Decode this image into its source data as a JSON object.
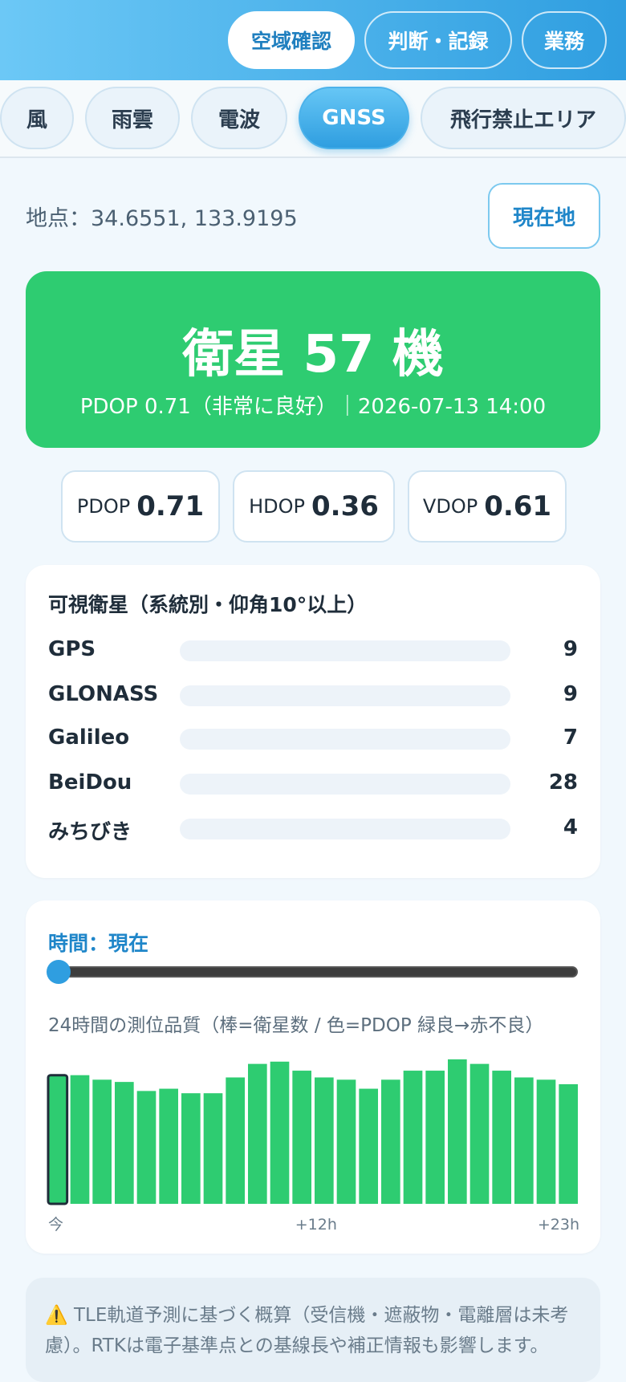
{
  "header": {
    "buttons": [
      {
        "label": "空域確認",
        "active": true
      },
      {
        "label": "判断・記録",
        "active": false
      },
      {
        "label": "業務",
        "active": false
      }
    ]
  },
  "subtabs": [
    {
      "label": "風",
      "active": false
    },
    {
      "label": "雨雲",
      "active": false
    },
    {
      "label": "電波",
      "active": false
    },
    {
      "label": "GNSS",
      "active": true
    },
    {
      "label": "飛行禁止エリア",
      "active": false
    }
  ],
  "location": {
    "text": "地点：34.6551, 133.9195",
    "button_label": "現在地"
  },
  "hero": {
    "count_text": "衛星 57 機",
    "subtitle": "PDOP 0.71（非常に良好）｜2026-07-13 14:00"
  },
  "dop": [
    {
      "label": "PDOP",
      "value": "0.71"
    },
    {
      "label": "HDOP",
      "value": "0.36"
    },
    {
      "label": "VDOP",
      "value": "0.61"
    }
  ],
  "visible": {
    "title": "可視衛星（系統別・仰角10°以上）",
    "systems": [
      {
        "name": "GPS",
        "count": "9"
      },
      {
        "name": "GLONASS",
        "count": "9"
      },
      {
        "name": "Galileo",
        "count": "7"
      },
      {
        "name": "BeiDou",
        "count": "28"
      },
      {
        "name": "みちびき",
        "count": "4"
      }
    ]
  },
  "timeline": {
    "title": "時間：現在",
    "slider_value": 0,
    "caption": "24時間の測位品質（棒=衛星数 / 色=PDOP 緑良→赤不良）",
    "bar_color": "#2ecc71",
    "selected_index": 0,
    "tick_labels": [
      "今",
      "+12h",
      "+23h"
    ]
  },
  "chart_data": {
    "type": "bar",
    "categories": [
      "0",
      "1",
      "2",
      "3",
      "4",
      "5",
      "6",
      "7",
      "8",
      "9",
      "10",
      "11",
      "12",
      "13",
      "14",
      "15",
      "16",
      "17",
      "18",
      "19",
      "20",
      "21",
      "22",
      "23"
    ],
    "values": [
      57,
      57,
      55,
      54,
      50,
      51,
      49,
      49,
      56,
      62,
      63,
      59,
      56,
      55,
      51,
      55,
      59,
      59,
      64,
      62,
      59,
      56,
      55,
      53
    ],
    "ylim": [
      0,
      64
    ]
  },
  "note": {
    "icon": "warning-icon",
    "text": "TLE軌道予測に基づく概算（受信機・遮蔽物・電離層は未考慮）。RTKは電子基準点との基線長や補正情報も影響します。"
  }
}
